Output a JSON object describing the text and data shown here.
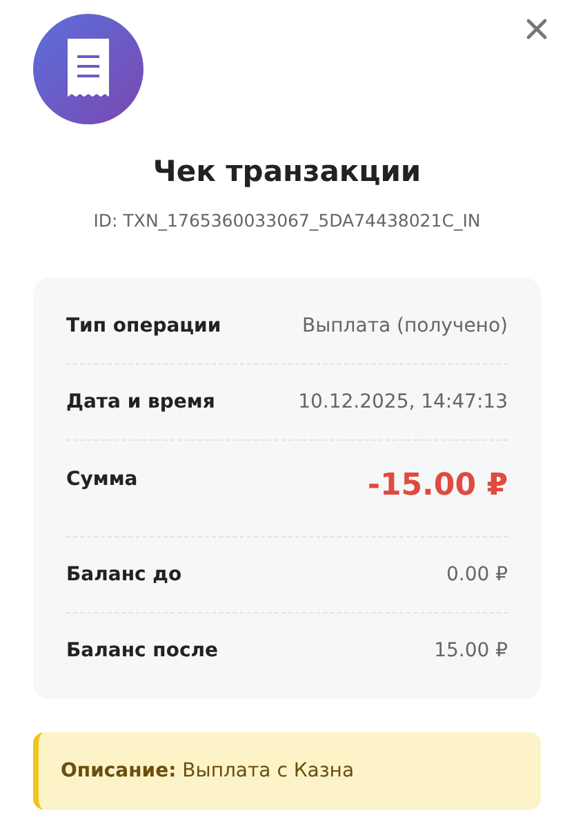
{
  "title": "Чек транзакции",
  "transaction_id": "ID: TXN_1765360033067_5DA74438021C_IN",
  "details": [
    {
      "kind": "text",
      "label": "Тип операции",
      "value": "Выплата (получено)"
    },
    {
      "kind": "text",
      "label": "Дата и время",
      "value": "10.12.2025, 14:47:13"
    },
    {
      "kind": "amount",
      "label": "Сумма",
      "value": "-15.00 ₽"
    },
    {
      "kind": "text",
      "label": "Баланс до",
      "value": "0.00 ₽"
    },
    {
      "kind": "text",
      "label": "Баланс после",
      "value": "15.00 ₽"
    }
  ],
  "description": "**Описание:** Выплата с Казна"
}
